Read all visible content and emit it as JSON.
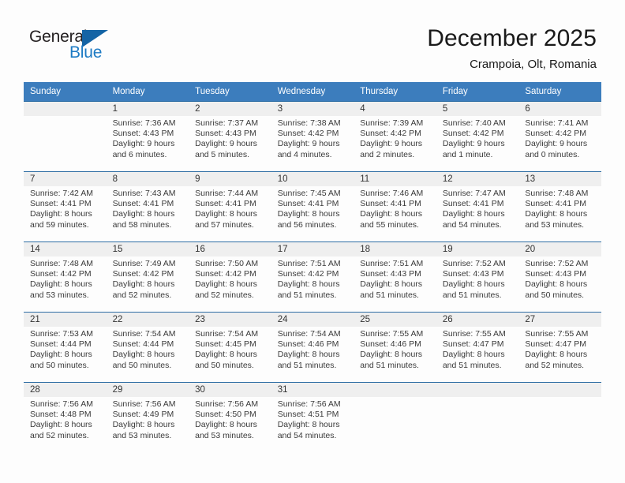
{
  "brand": {
    "name_part1": "General",
    "name_part2": "Blue",
    "accent_color": "#1e7bc4",
    "triangle_color": "#1464a5"
  },
  "header": {
    "title": "December 2025",
    "subtitle": "Crampoia, Olt, Romania"
  },
  "theme": {
    "header_row_bg": "#3c7dbd",
    "row_divider": "#2e6da4",
    "daynum_band_bg": "#efefef",
    "page_bg": "#fdfdfd"
  },
  "weekday_headers": [
    "Sunday",
    "Monday",
    "Tuesday",
    "Wednesday",
    "Thursday",
    "Friday",
    "Saturday"
  ],
  "weeks": [
    [
      {
        "day": "",
        "sunrise": "",
        "sunset": "",
        "daylight_line1": "",
        "daylight_line2": ""
      },
      {
        "day": "1",
        "sunrise": "Sunrise: 7:36 AM",
        "sunset": "Sunset: 4:43 PM",
        "daylight_line1": "Daylight: 9 hours",
        "daylight_line2": "and 6 minutes."
      },
      {
        "day": "2",
        "sunrise": "Sunrise: 7:37 AM",
        "sunset": "Sunset: 4:43 PM",
        "daylight_line1": "Daylight: 9 hours",
        "daylight_line2": "and 5 minutes."
      },
      {
        "day": "3",
        "sunrise": "Sunrise: 7:38 AM",
        "sunset": "Sunset: 4:42 PM",
        "daylight_line1": "Daylight: 9 hours",
        "daylight_line2": "and 4 minutes."
      },
      {
        "day": "4",
        "sunrise": "Sunrise: 7:39 AM",
        "sunset": "Sunset: 4:42 PM",
        "daylight_line1": "Daylight: 9 hours",
        "daylight_line2": "and 2 minutes."
      },
      {
        "day": "5",
        "sunrise": "Sunrise: 7:40 AM",
        "sunset": "Sunset: 4:42 PM",
        "daylight_line1": "Daylight: 9 hours",
        "daylight_line2": "and 1 minute."
      },
      {
        "day": "6",
        "sunrise": "Sunrise: 7:41 AM",
        "sunset": "Sunset: 4:42 PM",
        "daylight_line1": "Daylight: 9 hours",
        "daylight_line2": "and 0 minutes."
      }
    ],
    [
      {
        "day": "7",
        "sunrise": "Sunrise: 7:42 AM",
        "sunset": "Sunset: 4:41 PM",
        "daylight_line1": "Daylight: 8 hours",
        "daylight_line2": "and 59 minutes."
      },
      {
        "day": "8",
        "sunrise": "Sunrise: 7:43 AM",
        "sunset": "Sunset: 4:41 PM",
        "daylight_line1": "Daylight: 8 hours",
        "daylight_line2": "and 58 minutes."
      },
      {
        "day": "9",
        "sunrise": "Sunrise: 7:44 AM",
        "sunset": "Sunset: 4:41 PM",
        "daylight_line1": "Daylight: 8 hours",
        "daylight_line2": "and 57 minutes."
      },
      {
        "day": "10",
        "sunrise": "Sunrise: 7:45 AM",
        "sunset": "Sunset: 4:41 PM",
        "daylight_line1": "Daylight: 8 hours",
        "daylight_line2": "and 56 minutes."
      },
      {
        "day": "11",
        "sunrise": "Sunrise: 7:46 AM",
        "sunset": "Sunset: 4:41 PM",
        "daylight_line1": "Daylight: 8 hours",
        "daylight_line2": "and 55 minutes."
      },
      {
        "day": "12",
        "sunrise": "Sunrise: 7:47 AM",
        "sunset": "Sunset: 4:41 PM",
        "daylight_line1": "Daylight: 8 hours",
        "daylight_line2": "and 54 minutes."
      },
      {
        "day": "13",
        "sunrise": "Sunrise: 7:48 AM",
        "sunset": "Sunset: 4:41 PM",
        "daylight_line1": "Daylight: 8 hours",
        "daylight_line2": "and 53 minutes."
      }
    ],
    [
      {
        "day": "14",
        "sunrise": "Sunrise: 7:48 AM",
        "sunset": "Sunset: 4:42 PM",
        "daylight_line1": "Daylight: 8 hours",
        "daylight_line2": "and 53 minutes."
      },
      {
        "day": "15",
        "sunrise": "Sunrise: 7:49 AM",
        "sunset": "Sunset: 4:42 PM",
        "daylight_line1": "Daylight: 8 hours",
        "daylight_line2": "and 52 minutes."
      },
      {
        "day": "16",
        "sunrise": "Sunrise: 7:50 AM",
        "sunset": "Sunset: 4:42 PM",
        "daylight_line1": "Daylight: 8 hours",
        "daylight_line2": "and 52 minutes."
      },
      {
        "day": "17",
        "sunrise": "Sunrise: 7:51 AM",
        "sunset": "Sunset: 4:42 PM",
        "daylight_line1": "Daylight: 8 hours",
        "daylight_line2": "and 51 minutes."
      },
      {
        "day": "18",
        "sunrise": "Sunrise: 7:51 AM",
        "sunset": "Sunset: 4:43 PM",
        "daylight_line1": "Daylight: 8 hours",
        "daylight_line2": "and 51 minutes."
      },
      {
        "day": "19",
        "sunrise": "Sunrise: 7:52 AM",
        "sunset": "Sunset: 4:43 PM",
        "daylight_line1": "Daylight: 8 hours",
        "daylight_line2": "and 51 minutes."
      },
      {
        "day": "20",
        "sunrise": "Sunrise: 7:52 AM",
        "sunset": "Sunset: 4:43 PM",
        "daylight_line1": "Daylight: 8 hours",
        "daylight_line2": "and 50 minutes."
      }
    ],
    [
      {
        "day": "21",
        "sunrise": "Sunrise: 7:53 AM",
        "sunset": "Sunset: 4:44 PM",
        "daylight_line1": "Daylight: 8 hours",
        "daylight_line2": "and 50 minutes."
      },
      {
        "day": "22",
        "sunrise": "Sunrise: 7:54 AM",
        "sunset": "Sunset: 4:44 PM",
        "daylight_line1": "Daylight: 8 hours",
        "daylight_line2": "and 50 minutes."
      },
      {
        "day": "23",
        "sunrise": "Sunrise: 7:54 AM",
        "sunset": "Sunset: 4:45 PM",
        "daylight_line1": "Daylight: 8 hours",
        "daylight_line2": "and 50 minutes."
      },
      {
        "day": "24",
        "sunrise": "Sunrise: 7:54 AM",
        "sunset": "Sunset: 4:46 PM",
        "daylight_line1": "Daylight: 8 hours",
        "daylight_line2": "and 51 minutes."
      },
      {
        "day": "25",
        "sunrise": "Sunrise: 7:55 AM",
        "sunset": "Sunset: 4:46 PM",
        "daylight_line1": "Daylight: 8 hours",
        "daylight_line2": "and 51 minutes."
      },
      {
        "day": "26",
        "sunrise": "Sunrise: 7:55 AM",
        "sunset": "Sunset: 4:47 PM",
        "daylight_line1": "Daylight: 8 hours",
        "daylight_line2": "and 51 minutes."
      },
      {
        "day": "27",
        "sunrise": "Sunrise: 7:55 AM",
        "sunset": "Sunset: 4:47 PM",
        "daylight_line1": "Daylight: 8 hours",
        "daylight_line2": "and 52 minutes."
      }
    ],
    [
      {
        "day": "28",
        "sunrise": "Sunrise: 7:56 AM",
        "sunset": "Sunset: 4:48 PM",
        "daylight_line1": "Daylight: 8 hours",
        "daylight_line2": "and 52 minutes."
      },
      {
        "day": "29",
        "sunrise": "Sunrise: 7:56 AM",
        "sunset": "Sunset: 4:49 PM",
        "daylight_line1": "Daylight: 8 hours",
        "daylight_line2": "and 53 minutes."
      },
      {
        "day": "30",
        "sunrise": "Sunrise: 7:56 AM",
        "sunset": "Sunset: 4:50 PM",
        "daylight_line1": "Daylight: 8 hours",
        "daylight_line2": "and 53 minutes."
      },
      {
        "day": "31",
        "sunrise": "Sunrise: 7:56 AM",
        "sunset": "Sunset: 4:51 PM",
        "daylight_line1": "Daylight: 8 hours",
        "daylight_line2": "and 54 minutes."
      },
      {
        "day": "",
        "sunrise": "",
        "sunset": "",
        "daylight_line1": "",
        "daylight_line2": ""
      },
      {
        "day": "",
        "sunrise": "",
        "sunset": "",
        "daylight_line1": "",
        "daylight_line2": ""
      },
      {
        "day": "",
        "sunrise": "",
        "sunset": "",
        "daylight_line1": "",
        "daylight_line2": ""
      }
    ]
  ]
}
